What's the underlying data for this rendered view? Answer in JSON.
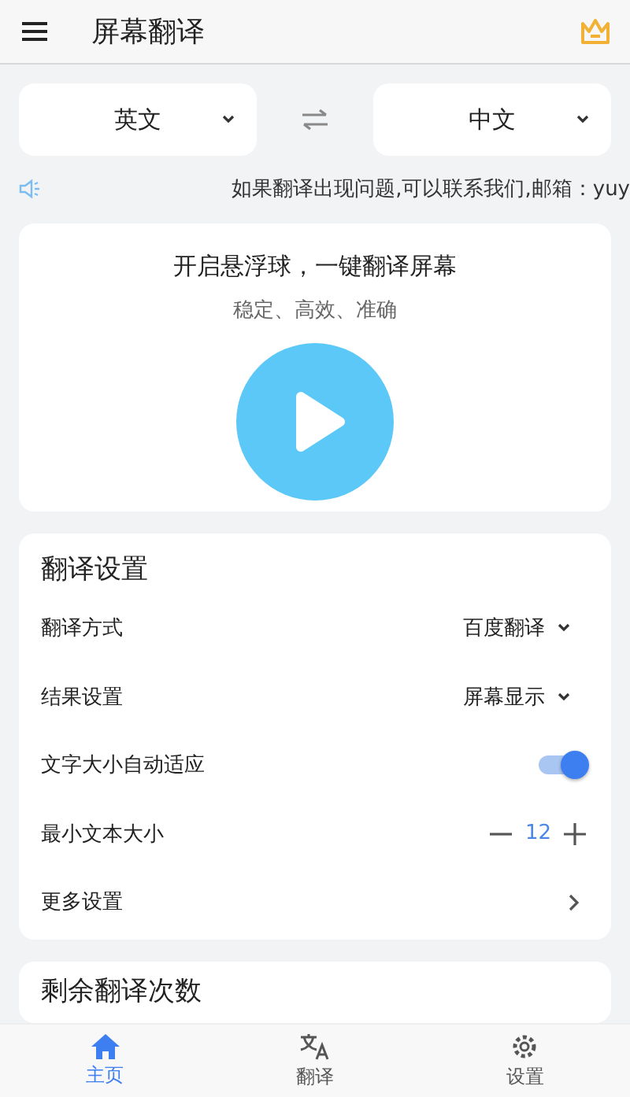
{
  "app_bar": {
    "title": "屏幕翻译"
  },
  "languages": {
    "source": "英文",
    "target": "中文"
  },
  "notice": "如果翻译出现问题,可以联系我们,邮箱：yuy",
  "float_card": {
    "title": "开启悬浮球，一键翻译屏幕",
    "subtitle": "稳定、高效、准确"
  },
  "settings": {
    "title": "翻译设置",
    "rows": [
      {
        "kind": "select",
        "label": "翻译方式",
        "value": "百度翻译"
      },
      {
        "kind": "select",
        "label": "结果设置",
        "value": "屏幕显示"
      },
      {
        "kind": "toggle",
        "label": "文字大小自动适应",
        "on": true
      },
      {
        "kind": "stepper",
        "label": "最小文本大小",
        "value": "12"
      },
      {
        "kind": "link",
        "label": "更多设置"
      }
    ]
  },
  "remaining_card": {
    "title": "剩余翻译次数"
  },
  "tabs": [
    {
      "label": "主页",
      "kind": "home",
      "selected": true
    },
    {
      "label": "翻译",
      "kind": "translate",
      "selected": false
    },
    {
      "label": "设置",
      "kind": "settings",
      "selected": false
    }
  ]
}
